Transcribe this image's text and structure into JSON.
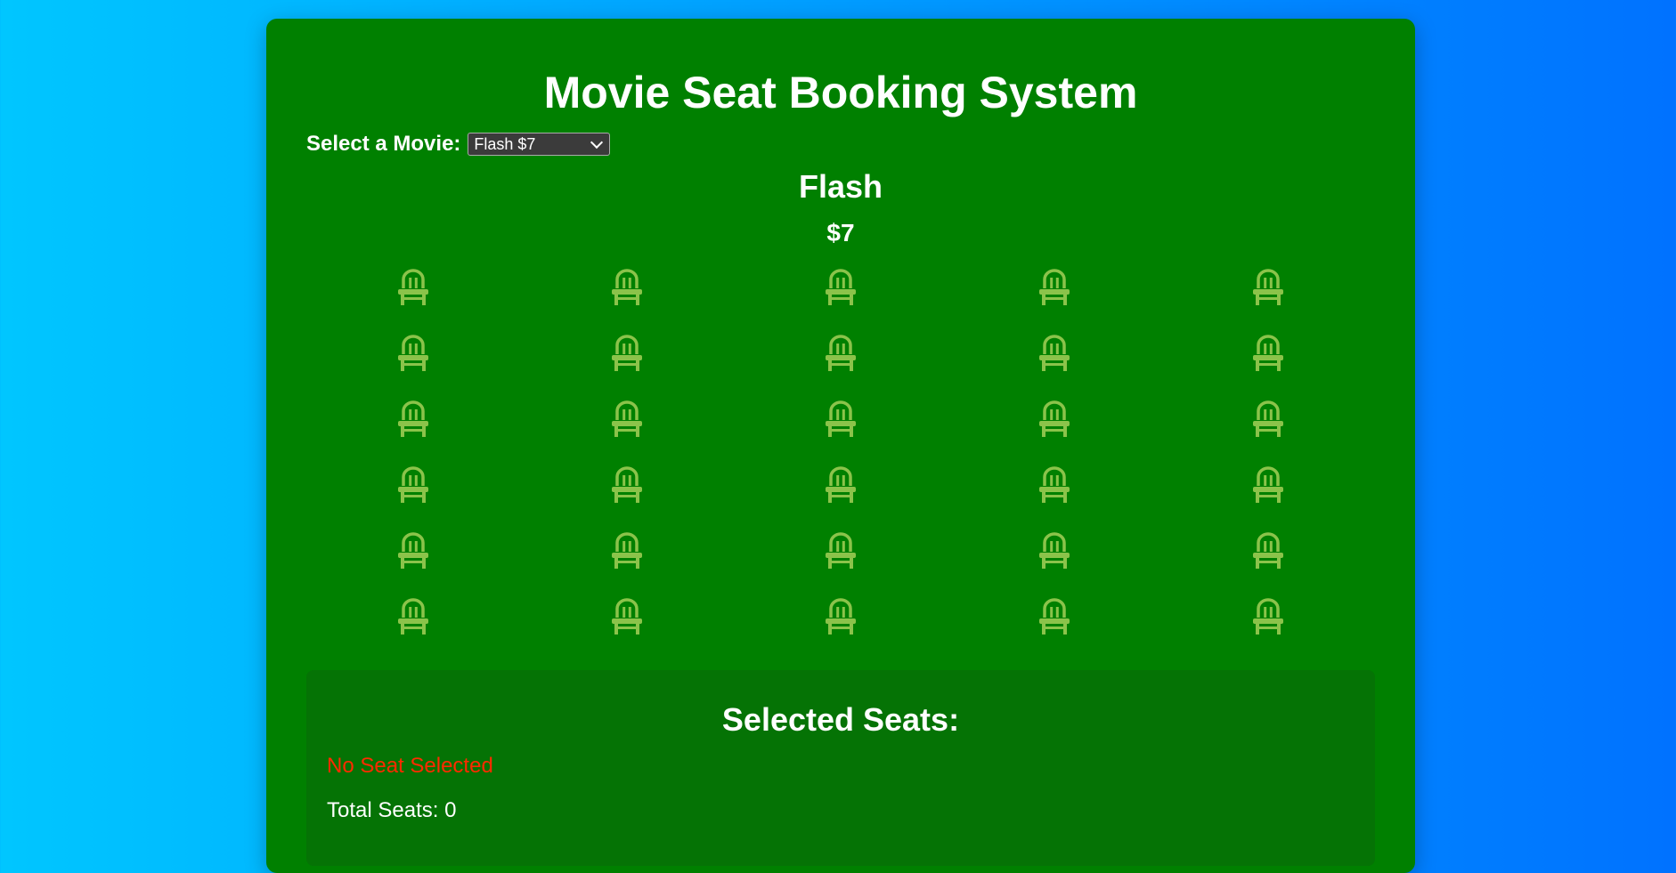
{
  "header": {
    "title": "Movie Seat Booking System"
  },
  "selector": {
    "label": "Select a Movie:",
    "selected_option": "Flash $7"
  },
  "movie": {
    "name": "Flash",
    "price": "$7"
  },
  "seats": {
    "rows": 6,
    "columns": 5,
    "icon": "seat-icon",
    "color": "#8bc34a"
  },
  "summary": {
    "heading": "Selected Seats:",
    "empty_message": "No Seat Selected",
    "total_label": "Total Seats: 0"
  },
  "colors": {
    "card_background": "#008000",
    "panel_background": "#057305",
    "empty_message": "#ff2a00"
  }
}
